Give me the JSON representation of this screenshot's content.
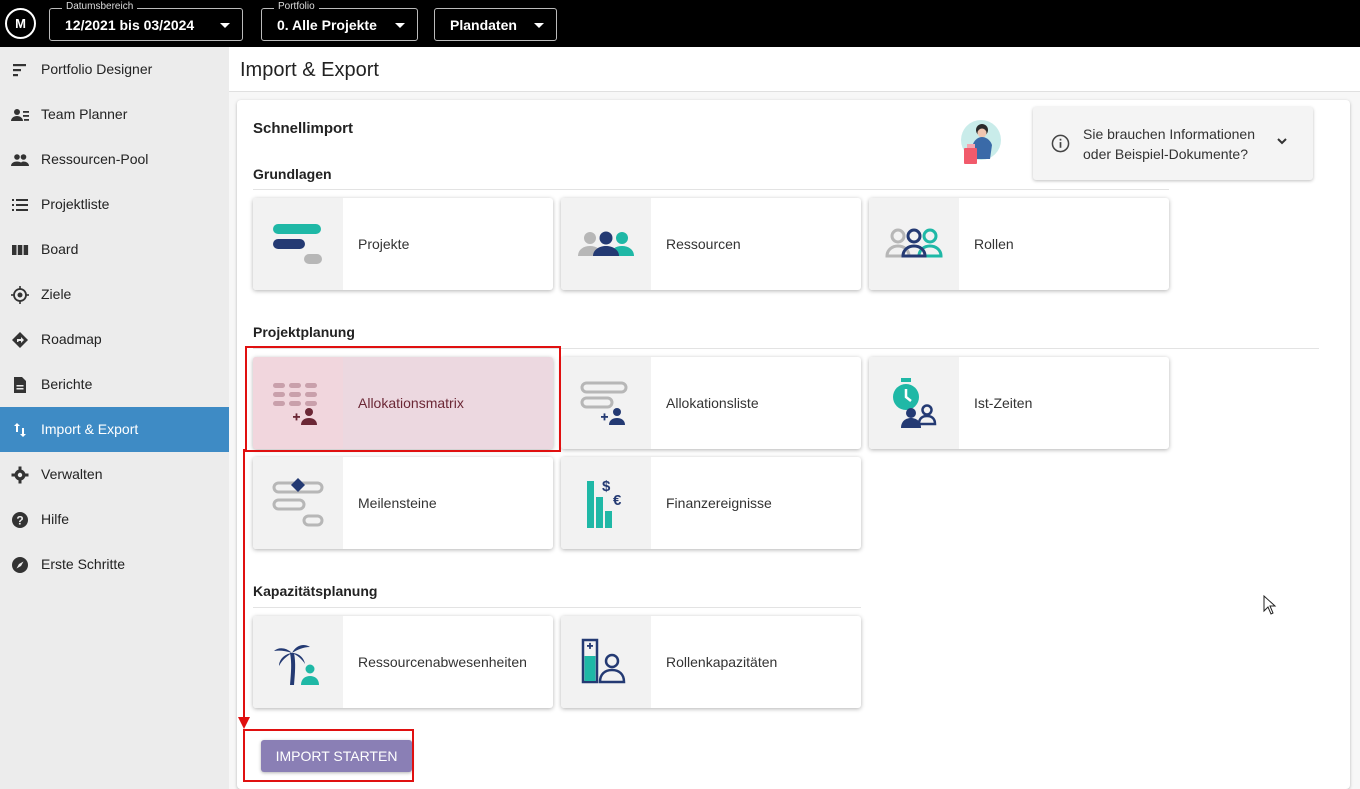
{
  "topbar": {
    "logo_text": "M",
    "date_range": {
      "label": "Datumsbereich",
      "value": "12/2021 bis 03/2024"
    },
    "portfolio": {
      "label": "Portfolio",
      "value": "0. Alle Projekte"
    },
    "data_mode": {
      "value": "Plandaten"
    }
  },
  "sidebar": {
    "items": [
      {
        "label": "Portfolio Designer",
        "icon": "portfolio-designer-icon"
      },
      {
        "label": "Team Planner",
        "icon": "team-planner-icon"
      },
      {
        "label": "Ressourcen-Pool",
        "icon": "people-icon"
      },
      {
        "label": "Projektliste",
        "icon": "list-icon"
      },
      {
        "label": "Board",
        "icon": "board-icon"
      },
      {
        "label": "Ziele",
        "icon": "target-icon"
      },
      {
        "label": "Roadmap",
        "icon": "roadmap-icon"
      },
      {
        "label": "Berichte",
        "icon": "document-icon"
      },
      {
        "label": "Import & Export",
        "icon": "import-export-icon",
        "active": true
      },
      {
        "label": "Verwalten",
        "icon": "gear-icon"
      },
      {
        "label": "Hilfe",
        "icon": "help-icon"
      },
      {
        "label": "Erste Schritte",
        "icon": "compass-icon"
      }
    ],
    "active_color": "#3e8bc5"
  },
  "page": {
    "title": "Import & Export",
    "quick_import_title": "Schnellimport",
    "info_text_line1": "Sie brauchen Informationen",
    "info_text_line2": "oder Beispiel-Dokumente?",
    "sections": {
      "basics": {
        "title": "Grundlagen",
        "tiles": [
          {
            "label": "Projekte",
            "icon": "projects-icon"
          },
          {
            "label": "Ressourcen",
            "icon": "resources-icon"
          },
          {
            "label": "Rollen",
            "icon": "roles-icon"
          }
        ]
      },
      "project_planning": {
        "title": "Projektplanung",
        "tiles": [
          {
            "label": "Allokationsmatrix",
            "icon": "allocation-matrix-icon",
            "selected": true
          },
          {
            "label": "Allokationsliste",
            "icon": "allocation-list-icon"
          },
          {
            "label": "Ist-Zeiten",
            "icon": "actual-times-icon"
          },
          {
            "label": "Meilensteine",
            "icon": "milestones-icon"
          },
          {
            "label": "Finanzereignisse",
            "icon": "finance-events-icon"
          }
        ]
      },
      "capacity_planning": {
        "title": "Kapazitätsplanung",
        "tiles": [
          {
            "label": "Ressourcenabwesenheiten",
            "icon": "absence-icon"
          },
          {
            "label": "Rollenkapazitäten",
            "icon": "role-capacity-icon"
          }
        ]
      }
    },
    "start_button": "IMPORT STARTEN"
  },
  "colors": {
    "teal": "#1fb8a6",
    "navy": "#243a73",
    "gray": "#b7b7b7",
    "button": "#8a7fb5",
    "highlight": "#e01010"
  }
}
